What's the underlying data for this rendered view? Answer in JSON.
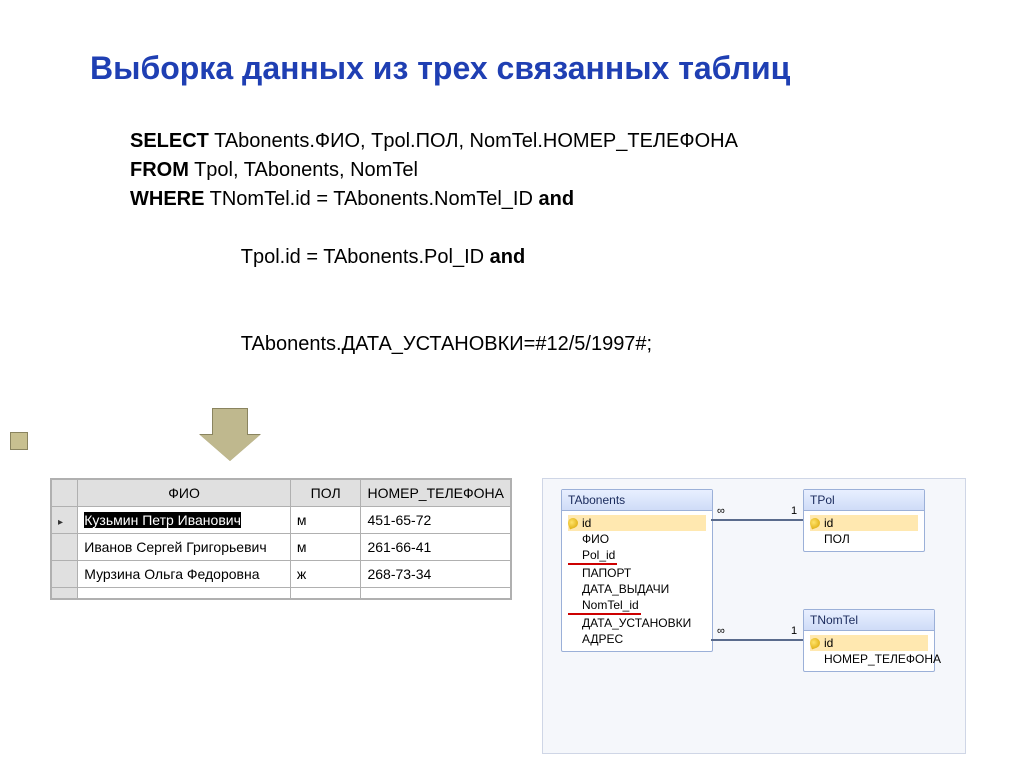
{
  "title": "Выборка данных из трех связанных таблиц",
  "sql": {
    "l1_kw": "SELECT",
    "l1": " TAbonents.ФИО, Tpol.ПОЛ, NomTel.НОМЕР_ТЕЛЕФОНА",
    "l2_kw": "FROM",
    "l2": " Tpol, TAbonents, NomTel",
    "l3_kw": "WHERE",
    "l3a": " TNomTel.id = TAbonents.NomTel_ID ",
    "l3_and": "and",
    "l4": "              Tpol.id = TAbonents.Pol_ID ",
    "l4_and": "and",
    "l5": "              TAbonents.ДАТА_УСТАНОВКИ=#12/5/1997#;"
  },
  "result": {
    "headers": [
      "ФИО",
      "ПОЛ",
      "НОМЕР_ТЕЛЕФОНА"
    ],
    "rows": [
      {
        "fio": "Кузьмин Петр Иванович",
        "pol": "м",
        "tel": "451-65-72",
        "selected": true
      },
      {
        "fio": "Иванов Сергей Григорьевич",
        "pol": "м",
        "tel": "261-66-41",
        "selected": false
      },
      {
        "fio": "Мурзина Ольга Федоровна",
        "pol": "ж",
        "tel": "268-73-34",
        "selected": false
      }
    ]
  },
  "schema": {
    "tabonents": {
      "title": "TAbonents",
      "fields": [
        "id",
        "ФИО",
        "Pol_id",
        "ПАПОРТ",
        "ДАТА_ВЫДАЧИ",
        "NomTel_id",
        "ДАТА_УСТАНОВКИ",
        "АДРЕС"
      ]
    },
    "tpol": {
      "title": "TPol",
      "fields": [
        "id",
        "ПОЛ"
      ]
    },
    "tnomtel": {
      "title": "TNomTel",
      "fields": [
        "id",
        "НОМЕР_ТЕЛЕФОНА"
      ]
    },
    "rel_one": "1",
    "rel_many": "∞"
  }
}
